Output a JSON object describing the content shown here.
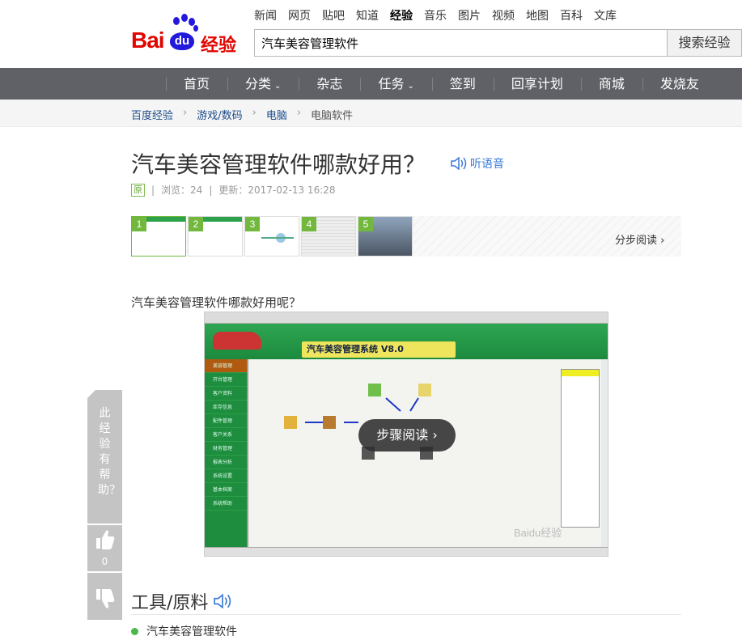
{
  "logo": {
    "text_bai": "Bai",
    "text_du": "du",
    "text_jingyan": "经验"
  },
  "topnav": [
    "新闻",
    "网页",
    "贴吧",
    "知道",
    "经验",
    "音乐",
    "图片",
    "视频",
    "地图",
    "百科",
    "文库"
  ],
  "topnav_active": "经验",
  "search": {
    "value": "汽车美容管理软件",
    "button": "搜索经验"
  },
  "mainnav": [
    {
      "label": "首页"
    },
    {
      "label": "分类",
      "caret": "⌄"
    },
    {
      "label": "杂志"
    },
    {
      "label": "任务",
      "caret": "⌄"
    },
    {
      "label": "签到"
    },
    {
      "label": "回享计划"
    },
    {
      "label": "商城"
    },
    {
      "label": "发烧友"
    }
  ],
  "breadcrumb": [
    "百度经验",
    "游戏/数码",
    "电脑",
    "电脑软件"
  ],
  "article": {
    "title": "汽车美容管理软件哪款好用？",
    "listen": "听语音",
    "badge": "原",
    "views": "浏览：24",
    "updated": "更新：2017-02-13 16:28",
    "step_read": "分步阅读 ›",
    "intro": "汽车美容管理软件哪款好用呢？",
    "image_overlay": "步骤阅读 ›",
    "tools_heading": "工具/原料",
    "tool_item": "汽车美容管理软件"
  },
  "thumbnails": [
    "1",
    "2",
    "3",
    "4",
    "5"
  ],
  "figure": {
    "app_title": "汽车美容管理系统",
    "version": "V8.0",
    "watermark": "Baidu经验",
    "side_items": [
      "美容管理",
      "开台管理",
      "客户资料",
      "库存信息",
      "配件管理",
      "客户关系",
      "财务管理",
      "报表分析",
      "系统设置",
      "基本档案",
      "系统帮助"
    ]
  },
  "help_widget": {
    "text": "此经验有帮助？",
    "upvotes": "0"
  },
  "colors": {
    "brand_red": "#e10601",
    "nav_bg": "#5f6167",
    "accent_green": "#4cb849",
    "link_blue": "#3879d9"
  }
}
